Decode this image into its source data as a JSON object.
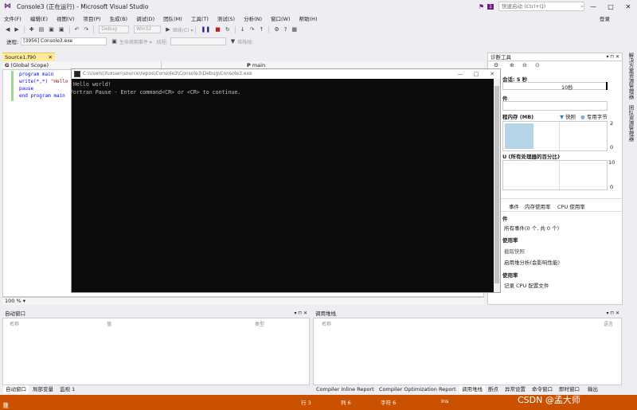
{
  "titlebar": {
    "title": "Console3 (正在运行) - Microsoft Visual Studio",
    "notification_count": "1",
    "quick_launch_placeholder": "快速启动 (Ctrl+Q)",
    "min": "—",
    "max": "□",
    "close": "✕"
  },
  "menu": [
    "文件(F)",
    "编辑(E)",
    "视图(V)",
    "项目(P)",
    "生成(B)",
    "调试(D)",
    "团队(M)",
    "工具(T)",
    "测试(S)",
    "分析(N)",
    "窗口(W)",
    "帮助(H)"
  ],
  "login": "登录",
  "toolbar1": {
    "config": "Debug",
    "platform": "Win32",
    "continue_label": "继续(C) ▾"
  },
  "toolbar2": {
    "process_label": "进程:",
    "process_value": "[3956] Console3.exe",
    "lifecycle_label": "生命周期事件 ▾",
    "thread_label": "线程:",
    "stackframe_label": "堆栈帧:"
  },
  "editor": {
    "tab": "Source1.f90",
    "scope": "(Global Scope)",
    "member": "main",
    "code": [
      {
        "kw": "program main",
        "str": ""
      },
      {
        "kw": "write(*,*) ",
        "str": "\"Hello world!\""
      },
      {
        "kw": "pause",
        "str": ""
      },
      {
        "kw": "end program main",
        "str": ""
      }
    ],
    "zoom": "100 %"
  },
  "console": {
    "title": "C:\\Users\\Yuxuan\\source\\repos\\Console3\\Console3\\Debug\\Console3.exe",
    "lines": [
      "Hello world!",
      "Fortran Pause - Enter command<CR> or <CR> to continue."
    ]
  },
  "diag": {
    "title": "诊断工具",
    "session": "会话: 5 秒",
    "timeline_tick": "10秒",
    "events_section": "件",
    "memory_section": "程内存 (MB)",
    "memory_legend_snapshot": "快照",
    "memory_legend_private": "专用字节",
    "mem_ymax": "2",
    "mem_ymin": "0",
    "cpu_section": "U (所有处理器的百分比)",
    "cpu_ymax": "10",
    "cpu_ymin": "0",
    "tabs": [
      "事件",
      "内存使用率",
      "CPU 使用率"
    ],
    "events_heading": "件",
    "events_summary": "所有事件(0 个, 共 0 个)",
    "memory_heading": "使用率",
    "memory_link": "截取快照",
    "memory_heap": "启用堆分析(会影响性能)",
    "cpu_heading": "使用率",
    "cpu_link": "记录 CPU 配置文件"
  },
  "vtabs": [
    "解决方案资源管理器",
    "团队资源管理器"
  ],
  "autos": {
    "title": "自动窗口",
    "cols": [
      "名称",
      "值",
      "类型"
    ],
    "tabs": [
      "自动窗口",
      "局部变量",
      "监视 1"
    ]
  },
  "callstack": {
    "title": "调用堆栈",
    "cols": [
      "名称",
      "语言"
    ],
    "tabs": [
      "Compiler Inline Report",
      "Compiler Optimization Report",
      "调用堆栈",
      "断点",
      "异常设置",
      "命令窗口",
      "即时窗口",
      "输出"
    ]
  },
  "status": {
    "ready": "就绪",
    "line": "行 3",
    "col": "列 6",
    "ch": "字符 6",
    "ins": "Ins",
    "watermark": "CSDN @孟大师"
  },
  "colors": {
    "accent": "#68217a",
    "status": "#ca5100",
    "console_bg": "#0c0c0c"
  }
}
